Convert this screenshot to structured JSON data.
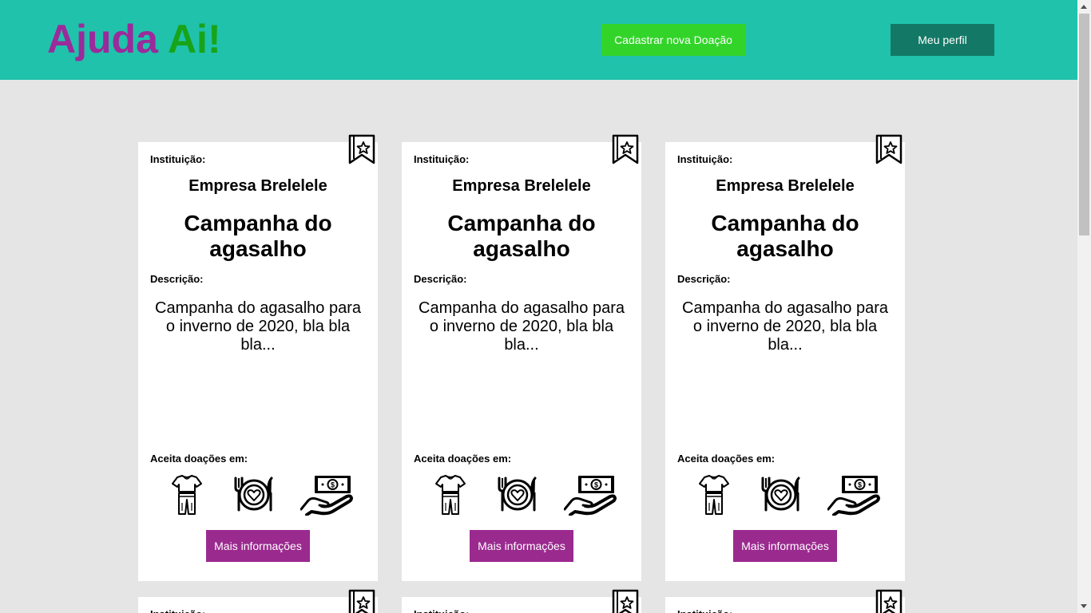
{
  "header": {
    "logo_part1": "Ajuda",
    "logo_part2": "Ai!",
    "new_donation_button": "Cadastrar nova Doação",
    "profile_button": "Meu perfil"
  },
  "card_labels": {
    "institution": "Instituição:",
    "description": "Descrição:",
    "accepts": "Aceita doações em:",
    "more_info": "Mais informações"
  },
  "cards": [
    {
      "institution": "Empresa Brelelele",
      "title": "Campanha do agasalho",
      "description": "Campanha do agasalho para o inverno de 2020, bla bla bla...",
      "accepts": [
        "clothes-icon",
        "food-icon",
        "money-icon"
      ]
    },
    {
      "institution": "Empresa Brelelele",
      "title": "Campanha do agasalho",
      "description": "Campanha do agasalho para o inverno de 2020, bla bla bla...",
      "accepts": [
        "clothes-icon",
        "food-icon",
        "money-icon"
      ]
    },
    {
      "institution": "Empresa Brelelele",
      "title": "Campanha do agasalho",
      "description": "Campanha do agasalho para o inverno de 2020, bla bla bla...",
      "accepts": [
        "clothes-icon",
        "food-icon",
        "money-icon"
      ]
    },
    {
      "institution": "",
      "title": "",
      "description": "",
      "accepts": []
    },
    {
      "institution": "",
      "title": "",
      "description": "",
      "accepts": []
    },
    {
      "institution": "",
      "title": "",
      "description": "",
      "accepts": []
    }
  ],
  "colors": {
    "header_bg": "#20c2ab",
    "logo_primary": "#9b2a9b",
    "logo_secondary": "#18a318",
    "new_button": "#33d42a",
    "profile_button": "#137966",
    "more_button": "#9b2a8f",
    "page_bg": "#e5e5e5"
  }
}
